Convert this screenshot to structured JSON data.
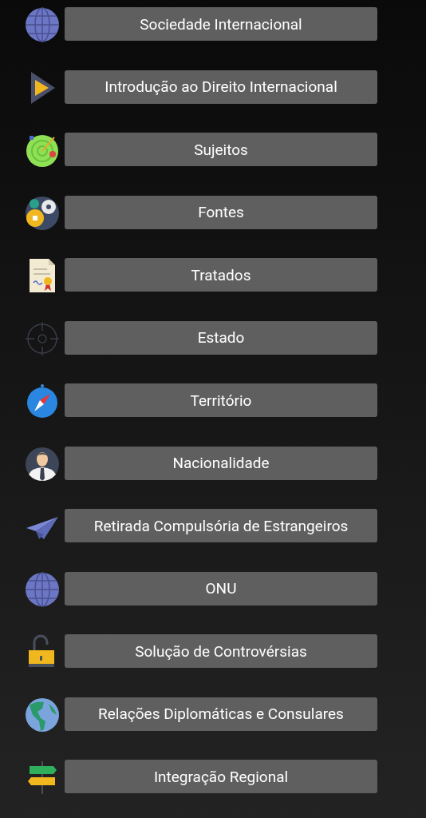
{
  "menu": [
    {
      "label": "Sociedade Internacional",
      "kind": "globe"
    },
    {
      "label": "Introdução ao Direito Internacional",
      "kind": "play"
    },
    {
      "label": "Sujeitos",
      "kind": "radar"
    },
    {
      "label": "Fontes",
      "kind": "gears"
    },
    {
      "label": "Tratados",
      "kind": "certificate"
    },
    {
      "label": "Estado",
      "kind": "crosshair"
    },
    {
      "label": "Território",
      "kind": "compass"
    },
    {
      "label": "Nacionalidade",
      "kind": "person"
    },
    {
      "label": "Retirada Compulsória de Estrangeiros",
      "kind": "plane"
    },
    {
      "label": "ONU",
      "kind": "globe"
    },
    {
      "label": "Solução de Controvérsias",
      "kind": "lock"
    },
    {
      "label": "Relações Diplomáticas e Consulares",
      "kind": "earth"
    },
    {
      "label": "Integração Regional",
      "kind": "signpost"
    }
  ]
}
